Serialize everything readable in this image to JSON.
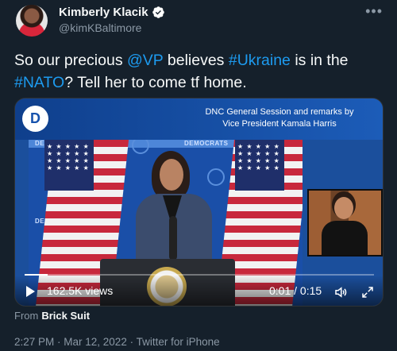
{
  "author": {
    "display_name": "Kimberly Klacik",
    "handle": "@kimKBaltimore",
    "verified": true
  },
  "more_icon": "ellipsis-icon",
  "tweet": {
    "text_parts": [
      {
        "text": "So our precious ",
        "type": "text"
      },
      {
        "text": "@VP",
        "type": "link"
      },
      {
        "text": " believes ",
        "type": "text"
      },
      {
        "text": "#Ukraine",
        "type": "link"
      },
      {
        "text": " is in the ",
        "type": "text"
      },
      {
        "text": "#NATO",
        "type": "link"
      },
      {
        "text": "? Tell her to come tf home.",
        "type": "text"
      }
    ]
  },
  "media": {
    "caption_line1": "DNC General Session and remarks by",
    "caption_line2": "Vice President Kamala Harris",
    "logo_letter": "D",
    "stage_text_1": "DEMOCRATS",
    "stage_text_2": "DEMOCRATS",
    "stage_text_3": "DEMO",
    "views": "162.5K views",
    "time": "0:01 / 0:15",
    "progress_fraction": 0.067
  },
  "source": {
    "prefix": "From",
    "app": "Brick Suit"
  },
  "footer": {
    "timestamp": "2:27 PM · Mar 12, 2022 · Twitter for iPhone"
  },
  "colors": {
    "background": "#15202b",
    "link": "#1d9bf0",
    "secondary_text": "#8b98a5"
  }
}
